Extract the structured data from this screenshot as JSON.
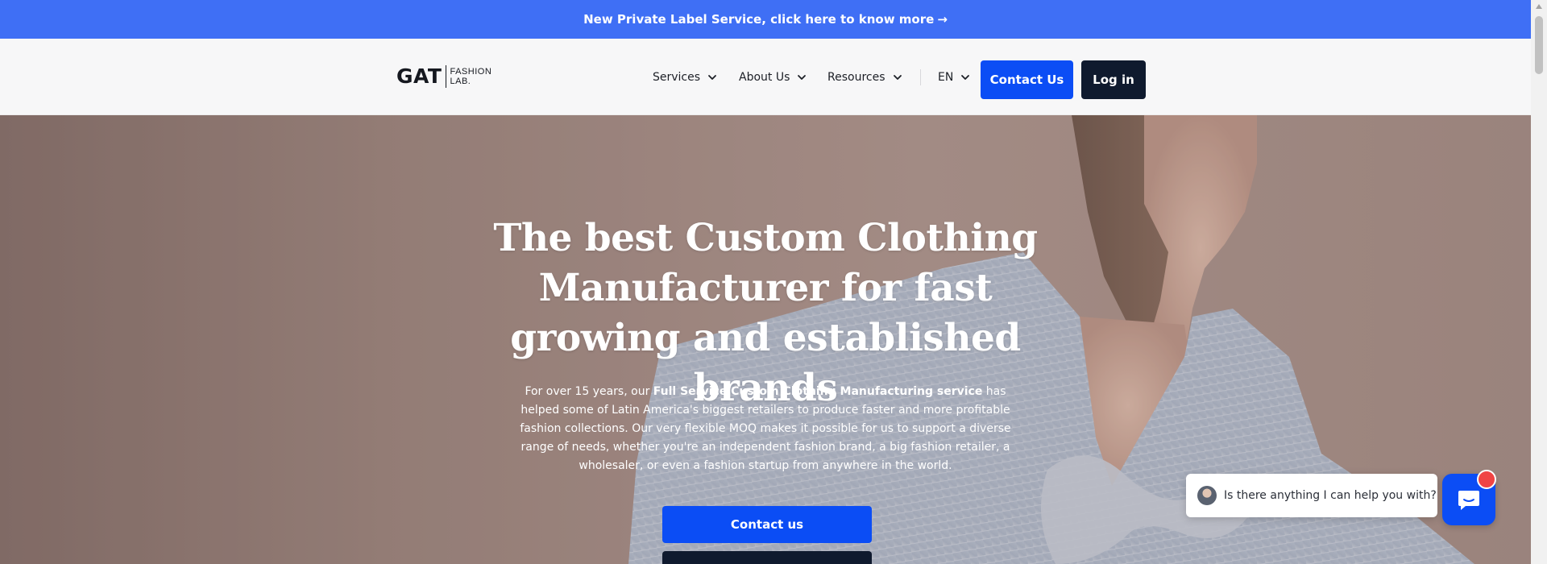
{
  "announcement": {
    "text": "New Private Label Service, click here to know more",
    "arrow": "→"
  },
  "logo": {
    "main": "GAT",
    "sub_line1": "FASHION",
    "sub_line2": "LAB."
  },
  "nav": {
    "items": [
      {
        "label": "Services",
        "icon": "chevron-down-icon"
      },
      {
        "label": "About Us",
        "icon": "chevron-down-icon"
      },
      {
        "label": "Resources",
        "icon": "chevron-down-icon"
      }
    ],
    "language": "EN",
    "contact_label": "Contact Us",
    "login_label": "Log in"
  },
  "hero": {
    "title": "The best Custom Clothing Manufacturer for fast growing and established brands",
    "desc_part1": "For over 15 years, our ",
    "desc_bold": "Full Service Custom Clothing Manufacturing service",
    "desc_part2": " has helped some of Latin America's biggest retailers to produce faster and more profitable fashion collections. Our very flexible MOQ makes it possible for us to support a diverse range of needs, whether you're an independent fashion brand, a big fashion retailer, a wholesaler, or even a fashion startup from anywhere in the world.",
    "cta_label": "Contact us"
  },
  "chat": {
    "message": "Is there anything I can help you with?",
    "launcher_icon": "chat-icon"
  },
  "colors": {
    "accent": "#0b4df5",
    "announcement_bg": "#3f6ff5",
    "dark": "#0f1a2e",
    "notification": "#f04444"
  }
}
